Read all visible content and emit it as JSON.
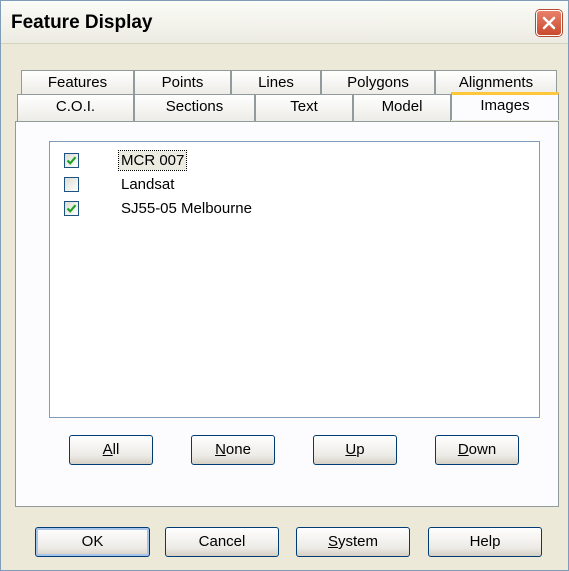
{
  "window": {
    "title": "Feature Display"
  },
  "tabs_row1": [
    "Features",
    "Points",
    "Lines",
    "Polygons",
    "Alignments"
  ],
  "tabs_row2": [
    "C.O.I.",
    "Sections",
    "Text",
    "Model",
    "Images"
  ],
  "active_tab": "Images",
  "images_list": {
    "items": [
      {
        "label": "MCR 007",
        "checked": true
      },
      {
        "label": "Landsat",
        "checked": false
      },
      {
        "label": "SJ55-05 Melbourne",
        "checked": true
      }
    ]
  },
  "list_buttons": {
    "all": {
      "mnemonic": "A",
      "rest": "ll"
    },
    "none": {
      "mnemonic": "N",
      "rest": "one"
    },
    "up": {
      "mnemonic": "U",
      "rest": "p"
    },
    "down": {
      "mnemonic": "D",
      "rest": "own"
    }
  },
  "dialog_buttons": {
    "ok": "OK",
    "cancel": "Cancel",
    "system": {
      "mnemonic": "S",
      "rest": "ystem"
    },
    "help": "Help"
  },
  "colors": {
    "check": "#21a121",
    "active_tab_accent": "#ffc83c",
    "close_button": "#c94a2d"
  }
}
